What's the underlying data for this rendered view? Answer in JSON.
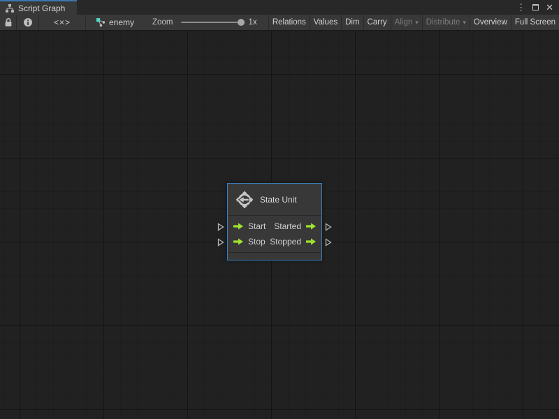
{
  "tab": {
    "title": "Script Graph"
  },
  "window_controls": {
    "menu_icon": "⋮",
    "close_icon": "✕"
  },
  "toolbar": {
    "code_toggle": "<×>",
    "breadcrumb": "enemy",
    "zoom": {
      "label": "Zoom",
      "value": "1x"
    },
    "dropdown_arrow": "▾",
    "buttons": [
      {
        "label": "Relations",
        "enabled": true,
        "dropdown": false
      },
      {
        "label": "Values",
        "enabled": true,
        "dropdown": false
      },
      {
        "label": "Dim",
        "enabled": true,
        "dropdown": false
      },
      {
        "label": "Carry",
        "enabled": true,
        "dropdown": false
      },
      {
        "label": "Align",
        "enabled": false,
        "dropdown": true
      },
      {
        "label": "Distribute",
        "enabled": false,
        "dropdown": true
      },
      {
        "label": "Overview",
        "enabled": true,
        "dropdown": false
      },
      {
        "label": "Full Screen",
        "enabled": true,
        "dropdown": false
      }
    ]
  },
  "node": {
    "title": "State Unit",
    "rows": [
      {
        "input": "Start",
        "output": "Started"
      },
      {
        "input": "Stop",
        "output": "Stopped"
      }
    ]
  },
  "colors": {
    "accent_blue": "#3c76b0",
    "selection_border": "#3a82c4",
    "port_green": "#9fe32f",
    "breadcrumb_teal": "#52d6c2",
    "canvas_bg": "#212121",
    "panel_bg": "#383838"
  }
}
